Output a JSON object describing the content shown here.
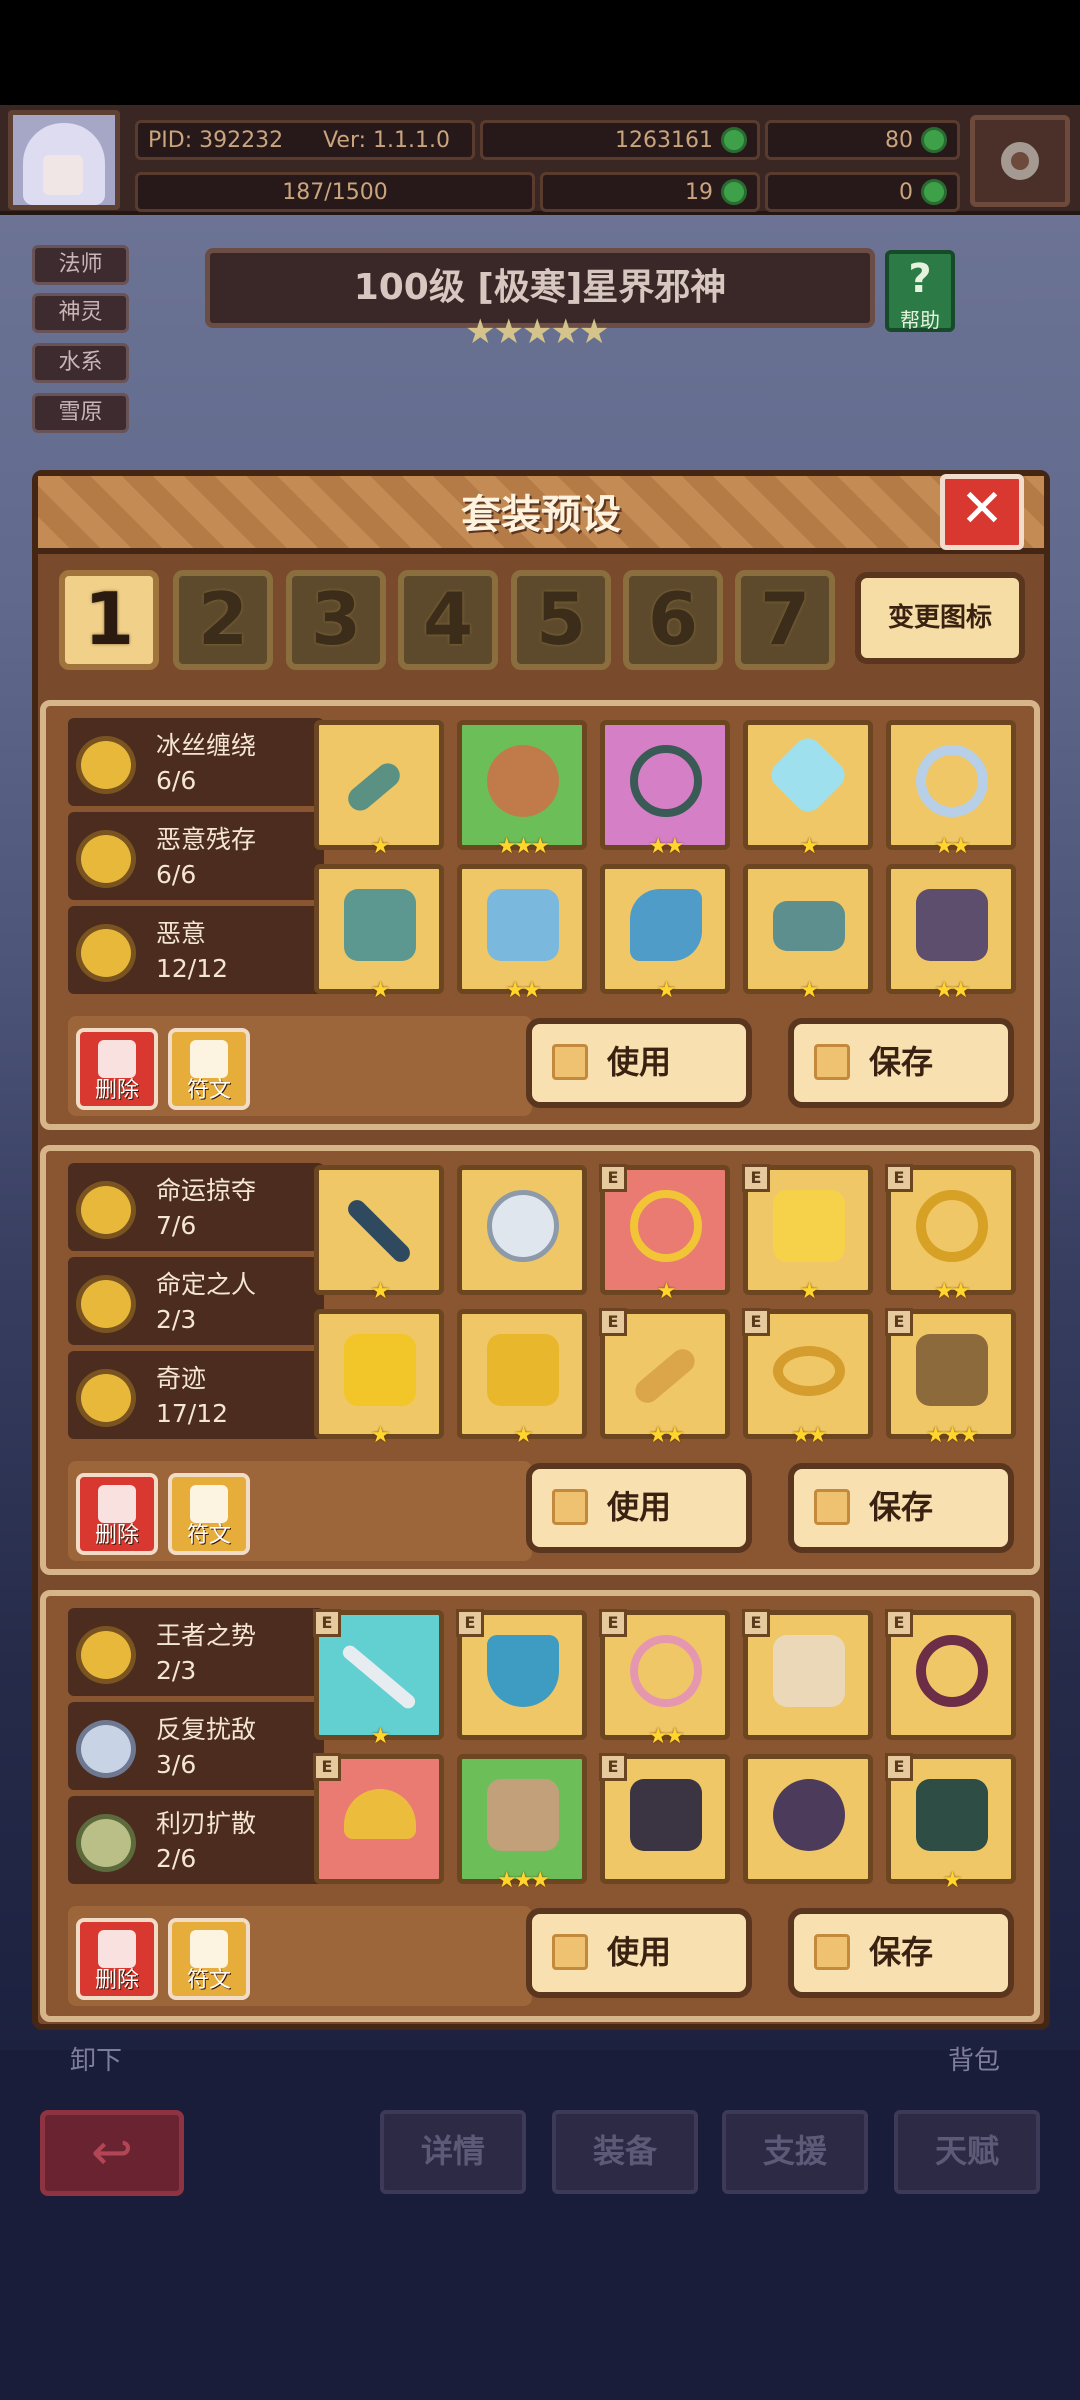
{
  "topbar": {
    "pid": "PID: 392232",
    "version": "Ver: 1.1.1.0",
    "gold": "1263161",
    "gems": "80",
    "xp": "187/1500",
    "clover": "19",
    "keys": "0"
  },
  "tags": [
    "法师",
    "神灵",
    "水系",
    "雪原"
  ],
  "boss": {
    "title": "100级  [极寒]星界邪神",
    "stars": "★★★★★",
    "help": "帮助"
  },
  "modal": {
    "title": "套装预设",
    "close": "✕",
    "tabs": [
      "1",
      "2",
      "3",
      "4",
      "5",
      "6",
      "7"
    ],
    "change_icon": "变更图标"
  },
  "sets": [
    {
      "bonuses": [
        {
          "name": "冰丝缠绕",
          "count": "6/6"
        },
        {
          "name": "恶意残存",
          "count": "6/6"
        },
        {
          "name": "恶意",
          "count": "12/12"
        }
      ],
      "items": [
        {
          "stars": "★"
        },
        {
          "stars": "★★★"
        },
        {
          "stars": "★★"
        },
        {
          "stars": "★"
        },
        {
          "stars": "★★"
        },
        {
          "stars": "★"
        },
        {
          "stars": "★★"
        },
        {
          "stars": "★"
        },
        {
          "stars": "★"
        },
        {
          "stars": "★★"
        }
      ],
      "delete": "删除",
      "rune": "符文",
      "use": "使用",
      "save": "保存"
    },
    {
      "bonuses": [
        {
          "name": "命运掠夺",
          "count": "7/6"
        },
        {
          "name": "命定之人",
          "count": "2/3"
        },
        {
          "name": "奇迹",
          "count": "17/12"
        }
      ],
      "items": [
        {
          "stars": "★"
        },
        {
          "stars": ""
        },
        {
          "stars": "★"
        },
        {
          "stars": "★"
        },
        {
          "stars": "★★"
        },
        {
          "stars": "★"
        },
        {
          "stars": "★"
        },
        {
          "stars": "★★"
        },
        {
          "stars": "★★"
        },
        {
          "stars": "★★★"
        }
      ],
      "delete": "删除",
      "rune": "符文",
      "use": "使用",
      "save": "保存"
    },
    {
      "bonuses": [
        {
          "name": "王者之势",
          "count": "2/3"
        },
        {
          "name": "反复扰敌",
          "count": "3/6"
        },
        {
          "name": "利刃扩散",
          "count": "2/6"
        }
      ],
      "items": [
        {
          "stars": "★"
        },
        {
          "stars": ""
        },
        {
          "stars": "★★"
        },
        {
          "stars": ""
        },
        {
          "stars": ""
        },
        {
          "stars": ""
        },
        {
          "stars": "★★★"
        },
        {
          "stars": ""
        },
        {
          "stars": ""
        },
        {
          "stars": "★"
        }
      ],
      "delete": "删除",
      "rune": "符文",
      "use": "使用",
      "save": "保存"
    }
  ],
  "under": {
    "unload": "卸下",
    "bag": "背包"
  },
  "nav": {
    "back": "↩",
    "details": "详情",
    "equipment": "装备",
    "support": "支援",
    "talent": "天赋"
  },
  "badge": "E"
}
